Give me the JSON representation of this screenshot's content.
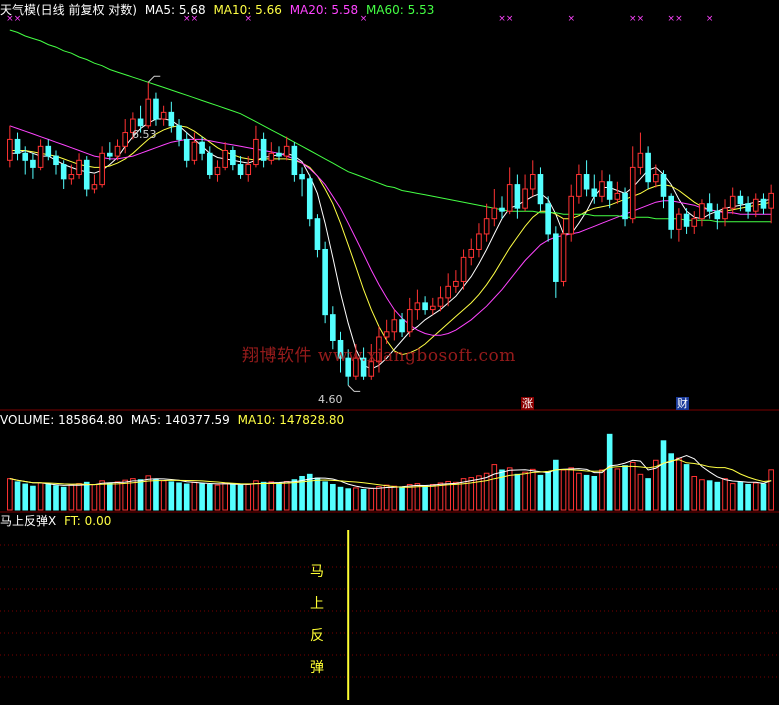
{
  "header": {
    "title": "天气模(日线 前复权 对数)",
    "ma5": "MA5: 5.68",
    "ma10": "MA10: 5.66",
    "ma20": "MA20: 5.58",
    "ma60": "MA60: 5.53"
  },
  "volume_header": {
    "label": "VOLUME: 185864.80",
    "ma5": "MA5: 140377.59",
    "ma10": "MA10: 147828.80"
  },
  "indicator_header": {
    "name": "马上反弹X",
    "ft": "FT: 0.00"
  },
  "indicator_signal_text": [
    "马",
    "上",
    "反",
    "弹"
  ],
  "watermark": "翔博软件 www.xiangbosoft.com",
  "annotations": {
    "high_label": "6.53",
    "low_label": "4.60",
    "badge_rise": "涨",
    "badge_finance": "财"
  },
  "colors": {
    "up": "#ff3333",
    "down": "#54ffff",
    "ma5": "#ffffff",
    "ma10": "#ffff44",
    "ma20": "#ff44ff",
    "ma60": "#44ff44",
    "grid": "#7a0000",
    "signal": "#ffff33",
    "x_marker": "#ff44ff"
  },
  "chart_data": {
    "type": "candlestick",
    "series": [
      {
        "name": "K",
        "values": [
          [
            5.95,
            6.1,
            6.2,
            5.9
          ],
          [
            6.1,
            6.0,
            6.15,
            5.95
          ],
          [
            6.0,
            5.95,
            6.05,
            5.85
          ],
          [
            5.95,
            5.9,
            6.0,
            5.82
          ],
          [
            5.9,
            6.05,
            6.1,
            5.88
          ],
          [
            6.05,
            5.98,
            6.1,
            5.95
          ],
          [
            5.98,
            5.92,
            6.02,
            5.85
          ],
          [
            5.92,
            5.82,
            5.95,
            5.75
          ],
          [
            5.82,
            5.85,
            5.92,
            5.78
          ],
          [
            5.85,
            5.95,
            6.0,
            5.82
          ],
          [
            5.95,
            5.75,
            5.98,
            5.7
          ],
          [
            5.75,
            5.78,
            5.85,
            5.72
          ],
          [
            5.78,
            6.0,
            6.05,
            5.76
          ],
          [
            6.0,
            5.98,
            6.08,
            5.95
          ],
          [
            5.98,
            6.05,
            6.1,
            5.95
          ],
          [
            6.05,
            6.15,
            6.25,
            6.0
          ],
          [
            6.15,
            6.25,
            6.3,
            6.1
          ],
          [
            6.25,
            6.2,
            6.35,
            6.15
          ],
          [
            6.2,
            6.4,
            6.53,
            6.18
          ],
          [
            6.4,
            6.25,
            6.45,
            6.2
          ],
          [
            6.25,
            6.3,
            6.35,
            6.2
          ],
          [
            6.3,
            6.2,
            6.38,
            6.15
          ],
          [
            6.2,
            6.1,
            6.25,
            6.05
          ],
          [
            6.1,
            5.95,
            6.15,
            5.9
          ],
          [
            5.95,
            6.08,
            6.15,
            5.92
          ],
          [
            6.08,
            6.0,
            6.12,
            5.95
          ],
          [
            6.0,
            5.85,
            6.05,
            5.82
          ],
          [
            5.85,
            5.9,
            5.95,
            5.8
          ],
          [
            5.9,
            6.02,
            6.08,
            5.88
          ],
          [
            6.02,
            5.92,
            6.05,
            5.88
          ],
          [
            5.92,
            5.85,
            5.98,
            5.82
          ],
          [
            5.85,
            5.92,
            5.98,
            5.8
          ],
          [
            5.92,
            6.1,
            6.2,
            5.9
          ],
          [
            6.1,
            5.95,
            6.15,
            5.9
          ],
          [
            5.95,
            6.0,
            6.08,
            5.92
          ],
          [
            6.0,
            5.98,
            6.05,
            5.95
          ],
          [
            5.98,
            6.05,
            6.12,
            5.95
          ],
          [
            6.05,
            5.85,
            6.08,
            5.8
          ],
          [
            5.85,
            5.82,
            5.9,
            5.7
          ],
          [
            5.82,
            5.55,
            5.85,
            5.5
          ],
          [
            5.55,
            5.35,
            5.58,
            5.3
          ],
          [
            5.35,
            4.95,
            5.4,
            4.9
          ],
          [
            4.95,
            4.8,
            5.0,
            4.75
          ],
          [
            4.8,
            4.7,
            4.85,
            4.62
          ],
          [
            4.7,
            4.6,
            4.75,
            4.55
          ],
          [
            4.6,
            4.7,
            4.78,
            4.58
          ],
          [
            4.7,
            4.6,
            4.76,
            4.58
          ],
          [
            4.6,
            4.68,
            4.78,
            4.58
          ],
          [
            4.68,
            4.82,
            4.88,
            4.62
          ],
          [
            4.82,
            4.85,
            4.92,
            4.78
          ],
          [
            4.85,
            4.92,
            4.98,
            4.8
          ],
          [
            4.92,
            4.85,
            4.96,
            4.82
          ],
          [
            4.85,
            4.98,
            5.05,
            4.82
          ],
          [
            4.98,
            5.02,
            5.1,
            4.92
          ],
          [
            5.02,
            4.98,
            5.06,
            4.95
          ],
          [
            4.98,
            5.0,
            5.05,
            4.95
          ],
          [
            5.0,
            5.05,
            5.12,
            4.97
          ],
          [
            5.05,
            5.12,
            5.2,
            5.0
          ],
          [
            5.12,
            5.15,
            5.22,
            5.08
          ],
          [
            5.15,
            5.3,
            5.35,
            5.1
          ],
          [
            5.3,
            5.35,
            5.42,
            5.25
          ],
          [
            5.35,
            5.45,
            5.52,
            5.3
          ],
          [
            5.45,
            5.55,
            5.65,
            5.4
          ],
          [
            5.55,
            5.62,
            5.75,
            5.5
          ],
          [
            5.62,
            5.6,
            5.7,
            5.55
          ],
          [
            5.6,
            5.78,
            5.9,
            5.58
          ],
          [
            5.78,
            5.62,
            5.85,
            5.55
          ],
          [
            5.62,
            5.75,
            5.85,
            5.6
          ],
          [
            5.75,
            5.85,
            5.95,
            5.7
          ],
          [
            5.85,
            5.65,
            5.9,
            5.6
          ],
          [
            5.65,
            5.45,
            5.7,
            5.4
          ],
          [
            5.45,
            5.15,
            5.5,
            5.05
          ],
          [
            5.15,
            5.45,
            5.55,
            5.12
          ],
          [
            5.45,
            5.7,
            5.78,
            5.4
          ],
          [
            5.7,
            5.85,
            5.92,
            5.65
          ],
          [
            5.85,
            5.75,
            5.95,
            5.7
          ],
          [
            5.75,
            5.7,
            5.85,
            5.65
          ],
          [
            5.7,
            5.8,
            5.88,
            5.66
          ],
          [
            5.8,
            5.68,
            5.85,
            5.62
          ],
          [
            5.68,
            5.72,
            5.8,
            5.65
          ],
          [
            5.72,
            5.55,
            5.76,
            5.5
          ],
          [
            5.55,
            5.9,
            6.05,
            5.52
          ],
          [
            5.9,
            6.0,
            6.15,
            5.85
          ],
          [
            6.0,
            5.8,
            6.05,
            5.75
          ],
          [
            5.8,
            5.85,
            5.92,
            5.76
          ],
          [
            5.85,
            5.7,
            5.88,
            5.62
          ],
          [
            5.7,
            5.48,
            5.72,
            5.42
          ],
          [
            5.48,
            5.58,
            5.62,
            5.4
          ],
          [
            5.58,
            5.5,
            5.62,
            5.45
          ],
          [
            5.5,
            5.55,
            5.6,
            5.45
          ],
          [
            5.55,
            5.65,
            5.68,
            5.5
          ],
          [
            5.65,
            5.6,
            5.72,
            5.55
          ],
          [
            5.6,
            5.55,
            5.65,
            5.48
          ],
          [
            5.55,
            5.62,
            5.68,
            5.5
          ],
          [
            5.62,
            5.7,
            5.76,
            5.58
          ],
          [
            5.7,
            5.65,
            5.74,
            5.6
          ],
          [
            5.65,
            5.6,
            5.7,
            5.55
          ],
          [
            5.6,
            5.68,
            5.72,
            5.56
          ],
          [
            5.68,
            5.62,
            5.72,
            5.58
          ],
          [
            5.62,
            5.72,
            5.78,
            5.52
          ]
        ]
      },
      {
        "name": "MA5",
        "values": [
          6.0,
          6.0,
          6.02,
          6.0,
          5.98,
          5.98,
          5.95,
          5.92,
          5.9,
          5.88,
          5.87,
          5.86,
          5.88,
          5.92,
          5.97,
          6.05,
          6.12,
          6.18,
          6.22,
          6.25,
          6.25,
          6.24,
          6.2,
          6.15,
          6.1,
          6.05,
          6.0,
          5.97,
          5.96,
          5.95,
          5.94,
          5.93,
          5.95,
          5.97,
          5.98,
          5.99,
          6.0,
          5.98,
          5.94,
          5.84,
          5.72,
          5.52,
          5.3,
          5.08,
          4.9,
          4.75,
          4.66,
          4.64,
          4.66,
          4.7,
          4.75,
          4.8,
          4.85,
          4.88,
          4.92,
          4.95,
          4.98,
          5.02,
          5.06,
          5.12,
          5.18,
          5.26,
          5.35,
          5.45,
          5.55,
          5.62,
          5.64,
          5.67,
          5.7,
          5.72,
          5.68,
          5.58,
          5.45,
          5.45,
          5.52,
          5.6,
          5.7,
          5.76,
          5.76,
          5.74,
          5.72,
          5.76,
          5.82,
          5.88,
          5.9,
          5.85,
          5.78,
          5.68,
          5.6,
          5.56,
          5.55,
          5.58,
          5.6,
          5.62,
          5.63,
          5.64,
          5.65,
          5.66,
          5.67,
          5.68
        ]
      },
      {
        "name": "MA10",
        "values": [
          6.02,
          6.02,
          6.02,
          6.01,
          6.0,
          5.99,
          5.98,
          5.96,
          5.94,
          5.92,
          5.91,
          5.9,
          5.9,
          5.91,
          5.93,
          5.96,
          6.0,
          6.05,
          6.1,
          6.14,
          6.17,
          6.19,
          6.2,
          6.19,
          6.16,
          6.12,
          6.08,
          6.04,
          6.01,
          5.99,
          5.97,
          5.96,
          5.95,
          5.96,
          5.96,
          5.96,
          5.96,
          5.95,
          5.93,
          5.9,
          5.84,
          5.75,
          5.65,
          5.52,
          5.38,
          5.24,
          5.1,
          4.98,
          4.88,
          4.8,
          4.74,
          4.72,
          4.73,
          4.75,
          4.78,
          4.82,
          4.86,
          4.9,
          4.94,
          4.98,
          5.02,
          5.07,
          5.13,
          5.2,
          5.28,
          5.36,
          5.43,
          5.5,
          5.56,
          5.6,
          5.6,
          5.58,
          5.55,
          5.55,
          5.57,
          5.6,
          5.62,
          5.63,
          5.64,
          5.66,
          5.68,
          5.7,
          5.72,
          5.75,
          5.77,
          5.78,
          5.77,
          5.74,
          5.7,
          5.66,
          5.63,
          5.61,
          5.6,
          5.6,
          5.61,
          5.62,
          5.63,
          5.64,
          5.65,
          5.66
        ]
      },
      {
        "name": "MA20",
        "values": [
          6.2,
          6.18,
          6.16,
          6.14,
          6.12,
          6.1,
          6.08,
          6.06,
          6.04,
          6.02,
          6.0,
          5.98,
          5.97,
          5.96,
          5.96,
          5.97,
          5.98,
          6.0,
          6.02,
          6.04,
          6.06,
          6.08,
          6.09,
          6.1,
          6.1,
          6.1,
          6.09,
          6.08,
          6.07,
          6.06,
          6.05,
          6.04,
          6.03,
          6.02,
          6.01,
          6.0,
          5.98,
          5.96,
          5.93,
          5.89,
          5.84,
          5.78,
          5.7,
          5.62,
          5.52,
          5.42,
          5.32,
          5.22,
          5.13,
          5.05,
          4.98,
          4.93,
          4.89,
          4.86,
          4.84,
          4.83,
          4.83,
          4.84,
          4.86,
          4.89,
          4.92,
          4.96,
          5.0,
          5.05,
          5.1,
          5.16,
          5.22,
          5.28,
          5.33,
          5.38,
          5.41,
          5.43,
          5.44,
          5.45,
          5.46,
          5.48,
          5.5,
          5.52,
          5.54,
          5.56,
          5.58,
          5.6,
          5.62,
          5.64,
          5.66,
          5.67,
          5.67,
          5.66,
          5.65,
          5.64,
          5.62,
          5.61,
          5.6,
          5.59,
          5.59,
          5.58,
          5.58,
          5.58,
          5.58,
          5.58
        ]
      },
      {
        "name": "MA60",
        "values": [
          6.95,
          6.93,
          6.9,
          6.88,
          6.86,
          6.83,
          6.81,
          6.78,
          6.76,
          6.73,
          6.71,
          6.68,
          6.66,
          6.63,
          6.61,
          6.59,
          6.57,
          6.55,
          6.53,
          6.51,
          6.49,
          6.47,
          6.45,
          6.43,
          6.41,
          6.39,
          6.37,
          6.35,
          6.33,
          6.31,
          6.29,
          6.26,
          6.23,
          6.2,
          6.17,
          6.14,
          6.11,
          6.08,
          6.05,
          6.02,
          5.99,
          5.96,
          5.93,
          5.9,
          5.87,
          5.85,
          5.83,
          5.81,
          5.79,
          5.77,
          5.76,
          5.74,
          5.73,
          5.72,
          5.71,
          5.7,
          5.69,
          5.68,
          5.67,
          5.66,
          5.65,
          5.64,
          5.63,
          5.62,
          5.61,
          5.6,
          5.6,
          5.6,
          5.6,
          5.59,
          5.59,
          5.59,
          5.58,
          5.58,
          5.58,
          5.58,
          5.57,
          5.57,
          5.57,
          5.57,
          5.56,
          5.56,
          5.56,
          5.56,
          5.55,
          5.55,
          5.55,
          5.55,
          5.54,
          5.54,
          5.54,
          5.54,
          5.53,
          5.53,
          5.53,
          5.53,
          5.53,
          5.53,
          5.53,
          5.53
        ]
      }
    ],
    "volume": [
      145000,
      130000,
      120000,
      110000,
      125000,
      118000,
      112000,
      105000,
      115000,
      122000,
      128000,
      118000,
      135000,
      125000,
      130000,
      138000,
      145000,
      140000,
      158000,
      142000,
      135000,
      130000,
      125000,
      120000,
      128000,
      122000,
      118000,
      115000,
      125000,
      120000,
      115000,
      118000,
      135000,
      128000,
      130000,
      125000,
      132000,
      140000,
      155000,
      165000,
      148000,
      130000,
      118000,
      105000,
      98000,
      102000,
      95000,
      100000,
      108000,
      115000,
      110000,
      105000,
      118000,
      122000,
      112000,
      118000,
      125000,
      132000,
      128000,
      145000,
      150000,
      158000,
      170000,
      210000,
      185000,
      195000,
      165000,
      175000,
      188000,
      160000,
      178000,
      230000,
      185000,
      195000,
      170000,
      160000,
      155000,
      185000,
      350000,
      190000,
      205000,
      220000,
      165000,
      145000,
      230000,
      320000,
      260000,
      240000,
      210000,
      155000,
      140000,
      135000,
      128000,
      145000,
      122000,
      130000,
      118000,
      125000,
      120000,
      185865
    ],
    "volume_ylim": [
      0,
      370000
    ],
    "indicator_ylim": [
      0,
      1
    ],
    "signal_index": 44,
    "x_marker_indices": [
      0,
      1,
      23,
      24,
      31,
      46,
      64,
      65,
      73,
      81,
      82,
      86,
      87,
      91
    ],
    "ylim": [
      4.45,
      7.05
    ]
  }
}
